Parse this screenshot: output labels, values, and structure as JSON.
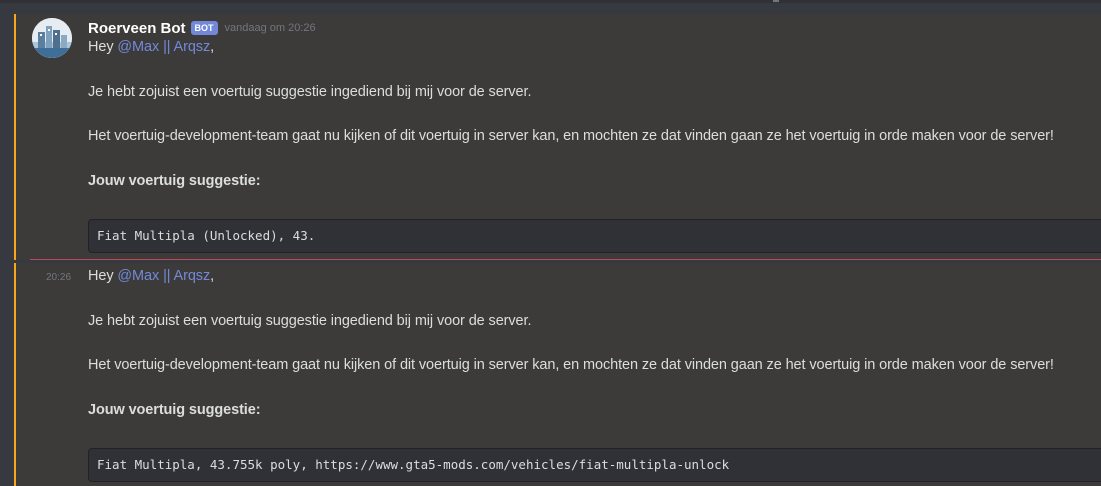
{
  "message1": {
    "author": "Roerveen Bot",
    "badge": "BOT",
    "timestamp": "vandaag om 20:26",
    "greeting": "Hey ",
    "mention": "@Max || Arqsz",
    "comma": ",",
    "line1": "Je hebt zojuist een voertuig suggestie ingediend bij mij voor de server.",
    "line2": "Het voertuig-development-team gaat nu kijken of dit voertuig in server kan, en mochten ze dat vinden gaan ze het voertuig in orde maken voor de server!",
    "heading": "Jouw voertuig suggestie:",
    "code": "Fiat Multipla (Unlocked), 43."
  },
  "message2": {
    "side_time": "20:26",
    "greeting": "Hey ",
    "mention": "@Max || Arqsz",
    "comma": ",",
    "line1": "Je hebt zojuist een voertuig suggestie ingediend bij mij voor de server.",
    "line2": "Het voertuig-development-team gaat nu kijken of dit voertuig in server kan, en mochten ze dat vinden gaan ze het voertuig in orde maken voor de server!",
    "heading": "Jouw voertuig suggestie:",
    "code": "Fiat Multipla, 43.755k poly, https://www.gta5-mods.com/vehicles/fiat-multipla-unlock"
  },
  "colors": {
    "background": "#36393f",
    "highlight": "#3c3b39",
    "accent_bar": "#faa61a",
    "mention": "#7289da",
    "new_divider": "#c04756"
  },
  "icons": {
    "avatar": "city-skyline-avatar"
  }
}
